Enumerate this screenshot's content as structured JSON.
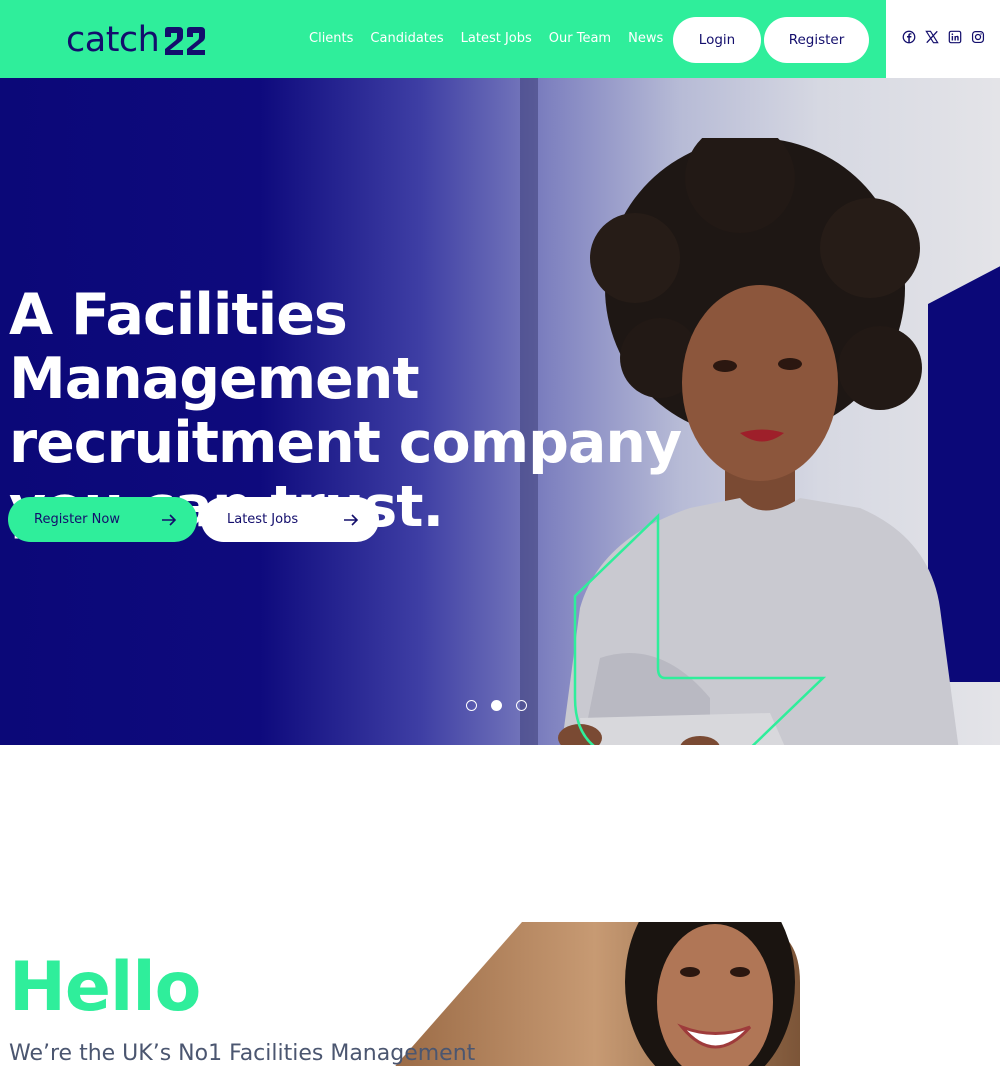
{
  "header": {
    "logo_text": "catch",
    "nav": [
      "Clients",
      "Candidates",
      "Latest Jobs",
      "Our Team",
      "News"
    ],
    "login_label": "Login",
    "register_label": "Register",
    "social_icons": [
      "facebook-icon",
      "x-icon",
      "linkedin-icon",
      "instagram-icon"
    ]
  },
  "hero": {
    "title_line1": "A Facilities Management",
    "title_line2": "recruitment company",
    "title_line3": "you can trust.",
    "register_now_label": "Register Now",
    "latest_jobs_label": "Latest Jobs",
    "slider_active_index": 1,
    "slide_count": 3
  },
  "hello": {
    "title": "Hello",
    "subtitle": "We’re the UK’s No1 Facilities Management"
  },
  "colors": {
    "brand_green": "#2fee9b",
    "brand_navy": "#130e6c",
    "hero_navy": "#0b0878"
  }
}
